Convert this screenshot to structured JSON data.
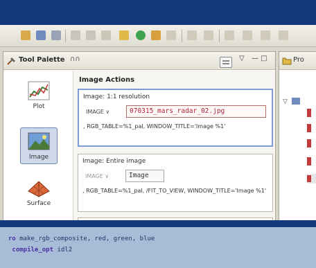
{
  "palette": {
    "title": "Tool Palette",
    "close_glyph": "∩∩",
    "min_glyph": "▽",
    "max_glyph": "— □"
  },
  "categories": [
    {
      "label": "Plot",
      "icon": "plot-icon"
    },
    {
      "label": "Image",
      "icon": "image-icon",
      "active": true
    },
    {
      "label": "Surface",
      "icon": "surface-icon"
    }
  ],
  "actions": {
    "heading": "Image Actions",
    "card1": {
      "title": "Image: 1:1 resolution",
      "param_label": "IMAGE ∨",
      "param_value": "070315_mars_radar_02.jpg",
      "extra": ", RGB_TABLE=%1_pal, WINDOW_TITLE='Image %1'"
    },
    "card2": {
      "title": "Image: Entire image",
      "param_label": "IMAGE ∨",
      "param_value": "Image",
      "extra": ", RGB_TABLE=%1_pal, /FIT_TO_VIEW, WINDOW_TITLE='Image %1'"
    }
  },
  "right_panel": {
    "title": "Pro"
  },
  "code": {
    "line1_kw": "ro",
    "line1_rest": " make_rgb_composite, red, green, blue",
    "line2_kw": " compile_opt",
    "line2_rest": " idl2"
  },
  "colors": {
    "banner": "#143a7b",
    "code_band": "#a7bcd7",
    "selection_border": "#7f9bd4",
    "param_text": "#b0203a"
  }
}
